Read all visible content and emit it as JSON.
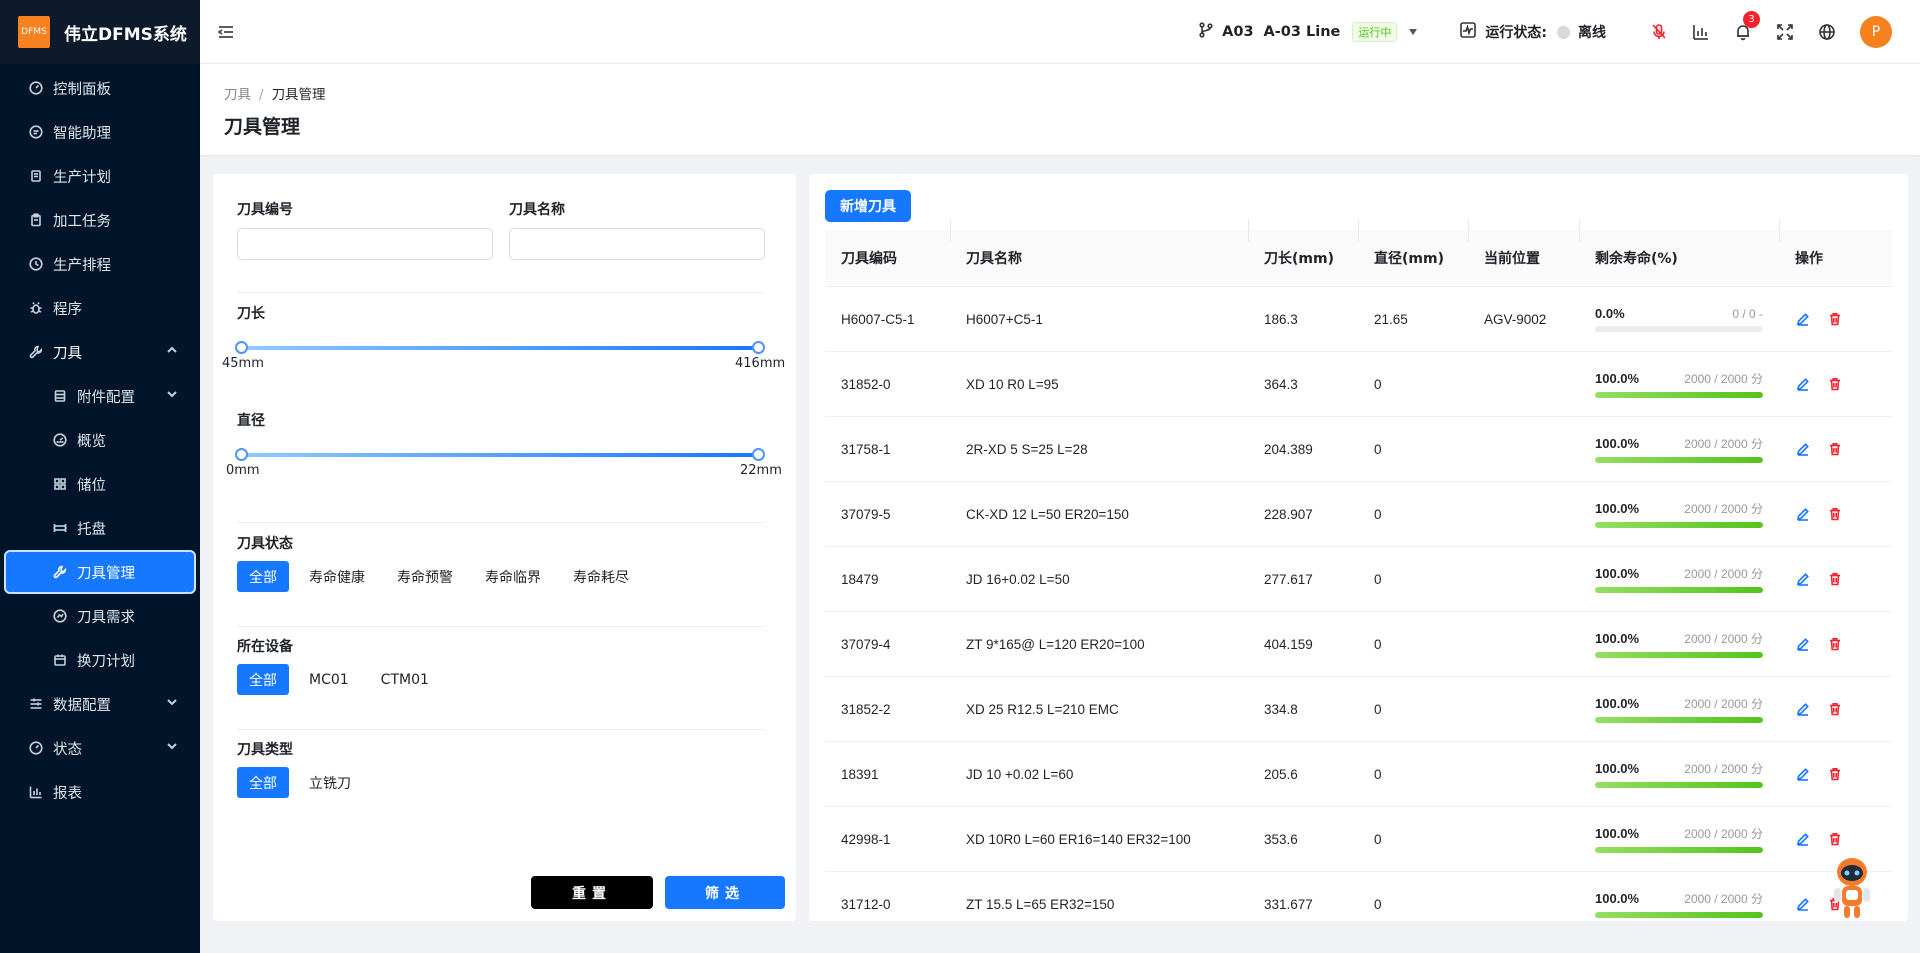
{
  "app": {
    "logo_badge": "DFMS",
    "title": "伟立DFMS系统"
  },
  "sidebar": {
    "items": [
      {
        "label": "控制面板",
        "icon": "dashboard-icon"
      },
      {
        "label": "智能助理",
        "icon": "assistant-icon"
      },
      {
        "label": "生产计划",
        "icon": "plan-icon"
      },
      {
        "label": "加工任务",
        "icon": "task-icon"
      },
      {
        "label": "生产排程",
        "icon": "schedule-icon"
      },
      {
        "label": "程序",
        "icon": "bug-icon"
      },
      {
        "label": "刀具",
        "icon": "tool-icon"
      },
      {
        "label": "附件配置",
        "icon": "attachment-icon"
      },
      {
        "label": "概览",
        "icon": "overview-icon"
      },
      {
        "label": "储位",
        "icon": "grid-icon"
      },
      {
        "label": "托盘",
        "icon": "pallet-icon"
      },
      {
        "label": "刀具管理",
        "icon": "tool-icon"
      },
      {
        "label": "刀具需求",
        "icon": "demand-icon"
      },
      {
        "label": "换刀计划",
        "icon": "calendar-icon"
      },
      {
        "label": "数据配置",
        "icon": "data-icon"
      },
      {
        "label": "状态",
        "icon": "status-icon"
      },
      {
        "label": "报表",
        "icon": "chart-icon"
      }
    ]
  },
  "header": {
    "line_code": "A03",
    "line_name": "A-03 Line",
    "line_status": "运行中",
    "run_status_label": "运行状态:",
    "run_status_value": "离线",
    "notification_count": "3",
    "avatar_letter": "P"
  },
  "page": {
    "breadcrumb_parent": "刀具",
    "breadcrumb_sep": "/",
    "breadcrumb_current": "刀具管理",
    "title": "刀具管理"
  },
  "filter": {
    "code_label": "刀具编号",
    "code_value": "",
    "name_label": "刀具名称",
    "name_value": "",
    "length_label": "刀长",
    "length_min": "45mm",
    "length_max": "416mm",
    "diameter_label": "直径",
    "diameter_min": "0mm",
    "diameter_max": "22mm",
    "status_label": "刀具状态",
    "status_options": [
      "全部",
      "寿命健康",
      "寿命预警",
      "寿命临界",
      "寿命耗尽"
    ],
    "device_label": "所在设备",
    "device_options": [
      "全部",
      "MC01",
      "CTM01"
    ],
    "type_label": "刀具类型",
    "type_options": [
      "全部",
      "立铣刀"
    ],
    "reset_label": "重置",
    "submit_label": "筛选"
  },
  "table": {
    "add_label": "新增刀具",
    "columns": [
      "刀具编码",
      "刀具名称",
      "刀长(mm)",
      "直径(mm)",
      "当前位置",
      "剩余寿命(%)",
      "操作"
    ],
    "rows": [
      {
        "code": "H6007-C5-1",
        "name": "H6007+C5-1",
        "length": "186.3",
        "diameter": "21.65",
        "location": "AGV-9002",
        "life_pct": "0.0%",
        "life_frac": 0,
        "life_info": "0 / 0 -"
      },
      {
        "code": "31852-0",
        "name": "XD 10 R0 L=95",
        "length": "364.3",
        "diameter": "0",
        "location": "",
        "life_pct": "100.0%",
        "life_frac": 1,
        "life_info": "2000 / 2000 分"
      },
      {
        "code": "31758-1",
        "name": "2R-XD 5 S=25 L=28",
        "length": "204.389",
        "diameter": "0",
        "location": "",
        "life_pct": "100.0%",
        "life_frac": 1,
        "life_info": "2000 / 2000 分"
      },
      {
        "code": "37079-5",
        "name": "CK-XD 12 L=50 ER20=150",
        "length": "228.907",
        "diameter": "0",
        "location": "",
        "life_pct": "100.0%",
        "life_frac": 1,
        "life_info": "2000 / 2000 分"
      },
      {
        "code": "18479",
        "name": "JD 16+0.02 L=50",
        "length": "277.617",
        "diameter": "0",
        "location": "",
        "life_pct": "100.0%",
        "life_frac": 1,
        "life_info": "2000 / 2000 分"
      },
      {
        "code": "37079-4",
        "name": "ZT 9*165@ L=120 ER20=100",
        "length": "404.159",
        "diameter": "0",
        "location": "",
        "life_pct": "100.0%",
        "life_frac": 1,
        "life_info": "2000 / 2000 分"
      },
      {
        "code": "31852-2",
        "name": "XD 25 R12.5 L=210 EMC",
        "length": "334.8",
        "diameter": "0",
        "location": "",
        "life_pct": "100.0%",
        "life_frac": 1,
        "life_info": "2000 / 2000 分"
      },
      {
        "code": "18391",
        "name": "JD 10 +0.02 L=60",
        "length": "205.6",
        "diameter": "0",
        "location": "",
        "life_pct": "100.0%",
        "life_frac": 1,
        "life_info": "2000 / 2000 分"
      },
      {
        "code": "42998-1",
        "name": "XD 10R0 L=60 ER16=140 ER32=100",
        "length": "353.6",
        "diameter": "0",
        "location": "",
        "life_pct": "100.0%",
        "life_frac": 1,
        "life_info": "2000 / 2000 分"
      },
      {
        "code": "31712-0",
        "name": "ZT 15.5 L=65 ER32=150",
        "length": "331.677",
        "diameter": "0",
        "location": "",
        "life_pct": "100.0%",
        "life_frac": 1,
        "life_info": "2000 / 2000 分"
      }
    ]
  }
}
